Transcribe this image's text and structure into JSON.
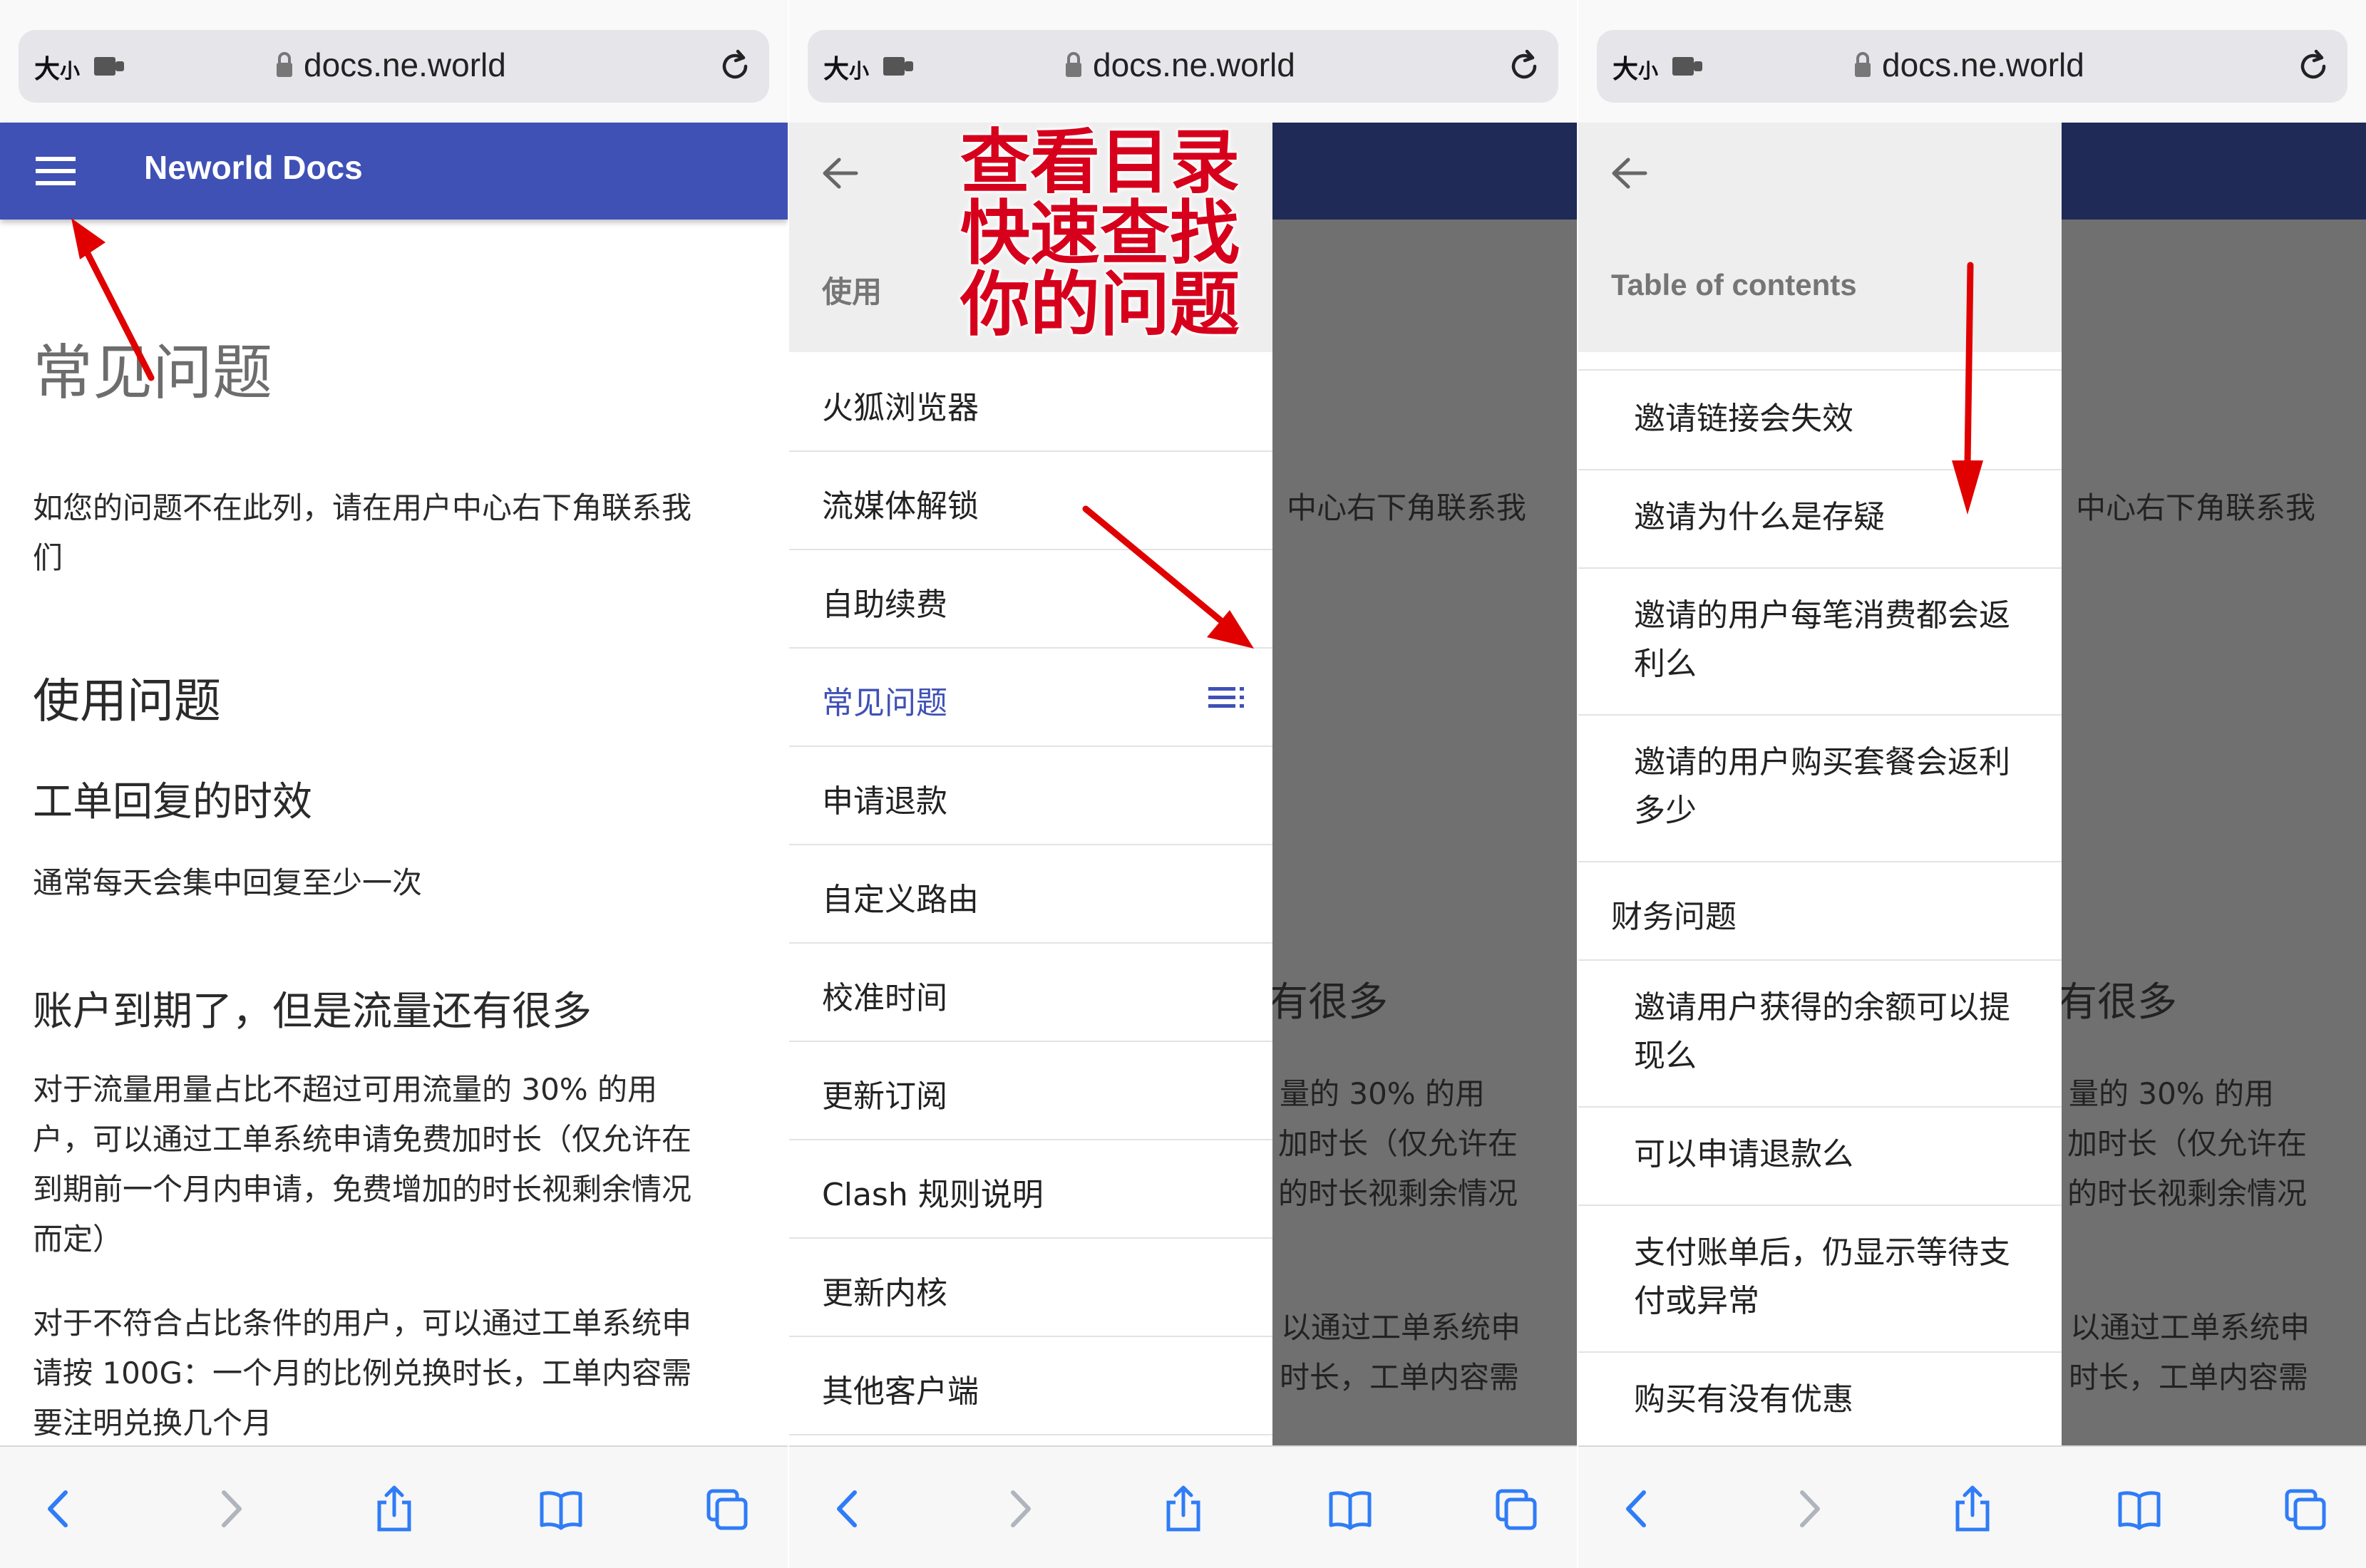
{
  "browser": {
    "text_size_label": "大小",
    "text_size_big": "大",
    "text_size_small": "小",
    "url": "docs.ne.world"
  },
  "panel1": {
    "app_title": "Neworld Docs",
    "page_title": "常见问题",
    "intro_line1": "如您的问题不在此列，请在用户中心右下角联系我",
    "intro_line2": "们",
    "section_usage": "使用问题",
    "q1_title": "工单回复的时效",
    "q1_body": "通常每天会集中回复至少一次",
    "q2_title": "账户到期了，但是流量还有很多",
    "q2_body_1": "对于流量用量占比不超过可用流量的 30% 的用",
    "q2_body_2": "户，可以通过工单系统申请免费加时长（仅允许在",
    "q2_body_3": "到期前一个月内申请，免费增加的时长视剩余情况",
    "q2_body_4": "而定）",
    "q2_body_5": "对于不符合占比条件的用户，可以通过工单系统申",
    "q2_body_6": "请按 100G：一个月的比例兑换时长，工单内容需",
    "q2_body_7": "要注明兑换几个月"
  },
  "panel2": {
    "drawer_title": "使用",
    "annotation_lines": [
      "查看目录",
      "快速查找",
      "你的问题"
    ],
    "nav_items": [
      {
        "label": "火狐浏览器",
        "active": false
      },
      {
        "label": "流媒体解锁",
        "active": false
      },
      {
        "label": "自助续费",
        "active": false
      },
      {
        "label": "常见问题",
        "active": true
      },
      {
        "label": "申请退款",
        "active": false
      },
      {
        "label": "自定义路由",
        "active": false
      },
      {
        "label": "校准时间",
        "active": false
      },
      {
        "label": "更新订阅",
        "active": false
      },
      {
        "label": "Clash 规则说明",
        "active": false
      },
      {
        "label": "更新内核",
        "active": false
      },
      {
        "label": "其他客户端",
        "active": false
      }
    ],
    "overlay_texts": [
      "中心右下角联系我",
      "有很多",
      "量的 30% 的用",
      "加时长（仅允许在",
      "的时长视剩余情况",
      "以通过工单系统申",
      "时长，工单内容需"
    ]
  },
  "panel3": {
    "drawer_title": "Table of contents",
    "toc": [
      {
        "line1": "邀请链接会失效",
        "line2": ""
      },
      {
        "line1": "邀请为什么是存疑",
        "line2": ""
      },
      {
        "line1": "邀请的用户每笔消费都会返",
        "line2": "利么"
      },
      {
        "line1": "邀请的用户购买套餐会返利",
        "line2": "多少"
      },
      {
        "line1": "财务问题",
        "line2": "",
        "section": true
      },
      {
        "line1": "邀请用户获得的余额可以提",
        "line2": "现么"
      },
      {
        "line1": "可以申请退款么",
        "line2": ""
      },
      {
        "line1": "支付账单后，仍显示等待支",
        "line2": "付或异常"
      },
      {
        "line1": "购买有没有优惠",
        "line2": ""
      }
    ],
    "overlay_texts": [
      "中心右下角联系我",
      "有很多",
      "量的 30% 的用",
      "加时长（仅允许在",
      "的时长视剩余情况",
      "以通过工单系统申",
      "时长，工单内容需"
    ]
  },
  "colors": {
    "app_bar": "#3f51b5",
    "active_link": "#3f51b5",
    "toolbar_icons": "#2f7cf6",
    "annotation_red": "#d6001c",
    "overlay_gray": "#707070"
  },
  "icons": {
    "top": [
      "text-size-icon",
      "extension-icon",
      "lock-icon",
      "reload-icon"
    ],
    "bottom": [
      "back-icon",
      "forward-icon",
      "share-icon",
      "bookmarks-icon",
      "tabs-icon"
    ],
    "app": [
      "menu-icon",
      "drawer-back-icon",
      "toc-icon"
    ]
  }
}
